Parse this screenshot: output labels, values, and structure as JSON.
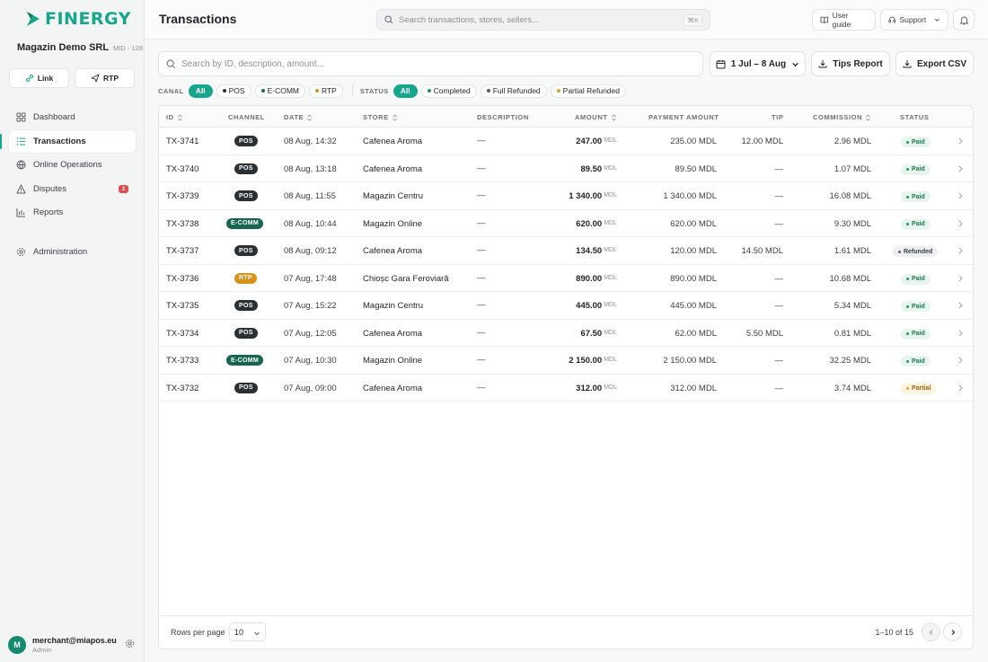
{
  "brand": {
    "name": "FINERGY",
    "color": "#16a68c"
  },
  "company": {
    "name": "Magazin Demo SRL",
    "mid": "MID · 128"
  },
  "quick_actions": {
    "link": "Link",
    "rtp": "RTP"
  },
  "nav": [
    {
      "label": "Dashboard",
      "icon": "grid-icon"
    },
    {
      "label": "Transactions",
      "icon": "list-icon",
      "active": true
    },
    {
      "label": "Online Operations",
      "icon": "globe-icon"
    },
    {
      "label": "Disputes",
      "icon": "warning-icon",
      "badge": "2"
    },
    {
      "label": "Reports",
      "icon": "bar-chart-icon"
    }
  ],
  "nav_admin": {
    "label": "Administration",
    "icon": "gear-icon"
  },
  "user": {
    "initial": "M",
    "email": "merchant@miapos.eu",
    "role": "Admin"
  },
  "topbar": {
    "title": "Transactions",
    "search_placeholder": "Search transactions, stores, sellers...",
    "shortcut": "⌘K",
    "user_guide": "User guide",
    "support": "Support"
  },
  "filters": {
    "search_placeholder": "Search by ID, description, amount...",
    "date_range": "1 Jul – 8 Aug",
    "tips_report": "Tips Report",
    "export_csv": "Export CSV",
    "canal_label": "CANAL",
    "canal_chips": [
      {
        "label": "All",
        "active": true
      },
      {
        "label": "POS",
        "dot": "#2b3034"
      },
      {
        "label": "E-COMM",
        "dot": "#17664e"
      },
      {
        "label": "RTP",
        "dot": "#d8921a"
      }
    ],
    "status_label": "STATUS",
    "status_chips": [
      {
        "label": "All",
        "active": true
      },
      {
        "label": "Completed",
        "dot": "#1c9a5c"
      },
      {
        "label": "Full Refunded",
        "dot": "#5b6066"
      },
      {
        "label": "Partial Refunded",
        "dot": "#e0a030"
      }
    ]
  },
  "table": {
    "headers": {
      "id": "ID",
      "channel": "CHANNEL",
      "date": "DATE",
      "store": "STORE",
      "description": "DESCRIPTION",
      "amount": "AMOUNT",
      "payment_amount": "PAYMENT AMOUNT",
      "tip": "TIP",
      "commission": "COMMISSION",
      "status": "STATUS"
    },
    "currency": "MDL",
    "rows": [
      {
        "id": "TX-3741",
        "channel": "POS",
        "date": "08 Aug, 14:32",
        "store": "Cafenea Aroma",
        "description": "—",
        "amount": "247.00",
        "payment": "235.00 MDL",
        "tip": "12.00 MDL",
        "commission": "2.96 MDL",
        "status": "Paid"
      },
      {
        "id": "TX-3740",
        "channel": "POS",
        "date": "08 Aug, 13:18",
        "store": "Cafenea Aroma",
        "description": "—",
        "amount": "89.50",
        "payment": "89.50 MDL",
        "tip": "—",
        "commission": "1.07 MDL",
        "status": "Paid"
      },
      {
        "id": "TX-3739",
        "channel": "POS",
        "date": "08 Aug, 11:55",
        "store": "Magazin Centru",
        "description": "—",
        "amount": "1 340.00",
        "payment": "1 340.00 MDL",
        "tip": "—",
        "commission": "16.08 MDL",
        "status": "Paid"
      },
      {
        "id": "TX-3738",
        "channel": "E-COMM",
        "date": "08 Aug, 10:44",
        "store": "Magazin Online",
        "description": "—",
        "amount": "620.00",
        "payment": "620.00 MDL",
        "tip": "—",
        "commission": "9.30 MDL",
        "status": "Paid"
      },
      {
        "id": "TX-3737",
        "channel": "POS",
        "date": "08 Aug, 09:12",
        "store": "Cafenea Aroma",
        "description": "—",
        "amount": "134.50",
        "payment": "120.00 MDL",
        "tip": "14.50 MDL",
        "commission": "1.61 MDL",
        "status": "Refunded"
      },
      {
        "id": "TX-3736",
        "channel": "RTP",
        "date": "07 Aug, 17:48",
        "store": "Chioșc Gara Feroviară",
        "description": "—",
        "amount": "890.00",
        "payment": "890.00 MDL",
        "tip": "—",
        "commission": "10.68 MDL",
        "status": "Paid"
      },
      {
        "id": "TX-3735",
        "channel": "POS",
        "date": "07 Aug, 15:22",
        "store": "Magazin Centru",
        "description": "—",
        "amount": "445.00",
        "payment": "445.00 MDL",
        "tip": "—",
        "commission": "5.34 MDL",
        "status": "Paid"
      },
      {
        "id": "TX-3734",
        "channel": "POS",
        "date": "07 Aug, 12:05",
        "store": "Cafenea Aroma",
        "description": "—",
        "amount": "67.50",
        "payment": "62.00 MDL",
        "tip": "5.50 MDL",
        "commission": "0.81 MDL",
        "status": "Paid"
      },
      {
        "id": "TX-3733",
        "channel": "E-COMM",
        "date": "07 Aug, 10:30",
        "store": "Magazin Online",
        "description": "—",
        "amount": "2 150.00",
        "payment": "2 150.00 MDL",
        "tip": "—",
        "commission": "32.25 MDL",
        "status": "Paid"
      },
      {
        "id": "TX-3732",
        "channel": "POS",
        "date": "07 Aug, 09:00",
        "store": "Cafenea Aroma",
        "description": "—",
        "amount": "312.00",
        "payment": "312.00 MDL",
        "tip": "—",
        "commission": "3.74 MDL",
        "status": "Partial"
      }
    ]
  },
  "pagination": {
    "rows_per_page_label": "Rows per page",
    "rows_per_page": "10",
    "range": "1–10 of 15"
  }
}
